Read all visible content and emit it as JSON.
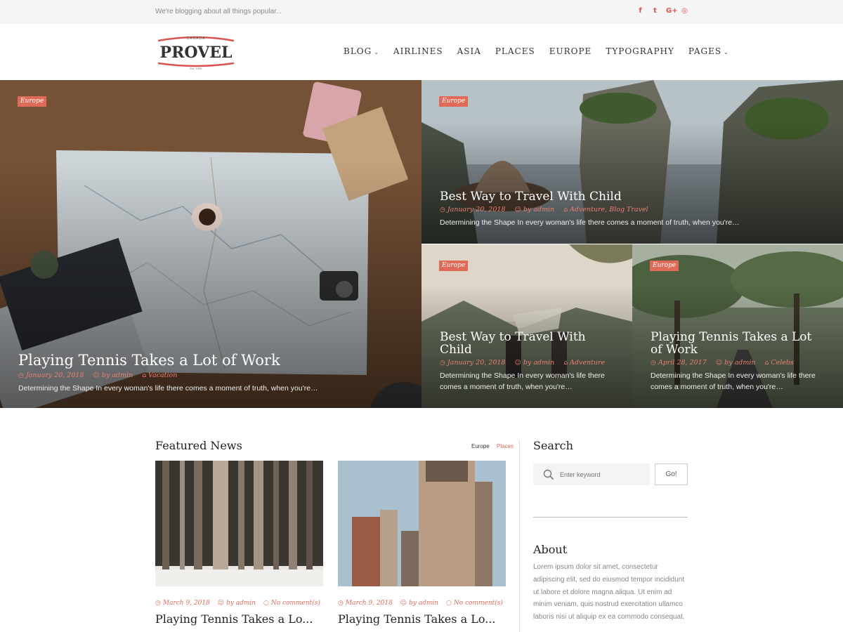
{
  "topbar": {
    "tagline": "We're blogging about all things popular...",
    "social": [
      {
        "icon": "facebook-icon",
        "glyph": "f"
      },
      {
        "icon": "twitter-icon",
        "glyph": "t"
      },
      {
        "icon": "google-plus-icon",
        "glyph": "G+"
      },
      {
        "icon": "instagram-icon",
        "glyph": "◎"
      }
    ]
  },
  "logo": {
    "top_text": "CANADA",
    "name": "PROVEL",
    "est": "Est. 1995",
    "accent": "#d9534f"
  },
  "nav": [
    {
      "label": "BLOG",
      "dropdown": true
    },
    {
      "label": "AIRLINES",
      "dropdown": false
    },
    {
      "label": "ASIA",
      "dropdown": false
    },
    {
      "label": "PLACES",
      "dropdown": false
    },
    {
      "label": "EUROPE",
      "dropdown": false
    },
    {
      "label": "TYPOGRAPHY",
      "dropdown": false
    },
    {
      "label": "PAGES",
      "dropdown": true
    }
  ],
  "hero": {
    "main": {
      "badge": "Europe",
      "title": "Playing Tennis Takes a Lot of Work",
      "date": "January 20, 2018",
      "author": "by admin",
      "category": "Vacation",
      "excerpt": "Determining the Shape In every woman's life there comes a moment of truth, when you're…"
    },
    "top_right": {
      "badge": "Europe",
      "title": "Best Way to Travel With Child",
      "date": "January 20, 2018",
      "author": "by admin",
      "category": "Adventure, Blog Travel",
      "excerpt": "Determining the Shape In every woman's life there comes a moment of truth, when you're…"
    },
    "bottom_middle": {
      "badge": "Europe",
      "title": "Best Way to Travel With Child",
      "date": "January 20, 2018",
      "author": "by admin",
      "category": "Adventure",
      "excerpt": "Determining the Shape In every woman's life there comes a moment of truth, when you're…"
    },
    "bottom_right": {
      "badge": "Europe",
      "title": "Playing Tennis Takes a Lot of Work",
      "date": "April 28, 2017",
      "author": "by admin",
      "category": "Celebs",
      "excerpt": "Determining the Shape In every woman's life there comes a moment of truth, when you're…"
    }
  },
  "featured": {
    "title": "Featured News",
    "tabs": [
      "Europe",
      "Places"
    ],
    "posts": [
      {
        "date": "March 9, 2018",
        "author": "by admin",
        "comments": "No comment(s)",
        "title": "Playing Tennis Takes a Lo..."
      },
      {
        "date": "March 9, 2018",
        "author": "by admin",
        "comments": "No comment(s)",
        "title": "Playing Tennis Takes a Lo..."
      }
    ]
  },
  "sidebar": {
    "search_title": "Search",
    "search_placeholder": "Enter keyword",
    "search_button": "Go!",
    "about_title": "About",
    "about_text": "Lorem ipsum dolor sit amet, consectetur adipiscing elit, sed do eiusmod tempor incididunt ut labore et dolore magna aliqua. Ut enim ad minim veniam, quis nostrud exercitation ullamco laboris nisi ut aliquip ex ea commodo consequat."
  },
  "colors": {
    "accent": "#e06a58",
    "topbar_bg": "#f5f5f5"
  }
}
